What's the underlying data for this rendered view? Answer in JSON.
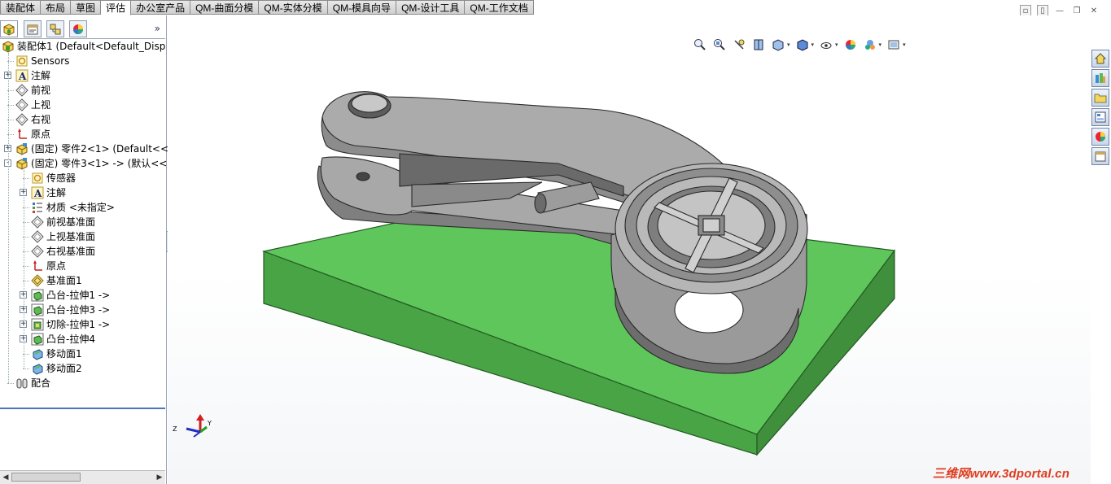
{
  "tabs": [
    {
      "label": "装配体",
      "active": false
    },
    {
      "label": "布局",
      "active": false
    },
    {
      "label": "草图",
      "active": false
    },
    {
      "label": "评估",
      "active": true
    },
    {
      "label": "办公室产品",
      "active": false
    },
    {
      "label": "QM-曲面分模",
      "active": false
    },
    {
      "label": "QM-实体分模",
      "active": false
    },
    {
      "label": "QM-模具向导",
      "active": false
    },
    {
      "label": "QM-设计工具",
      "active": false
    },
    {
      "label": "QM-工作文档",
      "active": false
    }
  ],
  "panel": {
    "more_glyph": "»",
    "tabs": [
      "featuremanager-icon",
      "propertymanager-icon",
      "configurationmanager-icon",
      "appearance-icon"
    ]
  },
  "tree": [
    {
      "label": "装配体1  (Default<Default_Disp",
      "icon": "assembly-icon",
      "level": 0,
      "expander": ""
    },
    {
      "label": "Sensors",
      "icon": "sensor-icon",
      "level": 1,
      "expander": ""
    },
    {
      "label": "注解",
      "icon": "annotation-icon",
      "level": 1,
      "expander": "+"
    },
    {
      "label": "前视",
      "icon": "plane-icon",
      "level": 1,
      "expander": ""
    },
    {
      "label": "上视",
      "icon": "plane-icon",
      "level": 1,
      "expander": ""
    },
    {
      "label": "右视",
      "icon": "plane-icon",
      "level": 1,
      "expander": ""
    },
    {
      "label": "原点",
      "icon": "origin-icon",
      "level": 1,
      "expander": ""
    },
    {
      "label": "(固定) 零件2<1> (Default<<D",
      "icon": "part-icon",
      "level": 1,
      "expander": "+"
    },
    {
      "label": "(固定) 零件3<1> -> (默认<<默",
      "icon": "part-icon",
      "level": 1,
      "expander": "-"
    },
    {
      "label": "传感器",
      "icon": "sensor-icon",
      "level": 2,
      "expander": ""
    },
    {
      "label": "注解",
      "icon": "annotation-icon",
      "level": 2,
      "expander": "+"
    },
    {
      "label": "材质 <未指定>",
      "icon": "material-icon",
      "level": 2,
      "expander": ""
    },
    {
      "label": "前视基准面",
      "icon": "plane-icon",
      "level": 2,
      "expander": ""
    },
    {
      "label": "上视基准面",
      "icon": "plane-icon",
      "level": 2,
      "expander": ""
    },
    {
      "label": "右视基准面",
      "icon": "plane-icon",
      "level": 2,
      "expander": ""
    },
    {
      "label": "原点",
      "icon": "origin-icon",
      "level": 2,
      "expander": ""
    },
    {
      "label": "基准面1",
      "icon": "ref-plane-icon",
      "level": 2,
      "expander": ""
    },
    {
      "label": "凸台-拉伸1 ->",
      "icon": "boss-extrude-icon",
      "level": 2,
      "expander": "+"
    },
    {
      "label": "凸台-拉伸3 ->",
      "icon": "boss-extrude-icon",
      "level": 2,
      "expander": "+"
    },
    {
      "label": "切除-拉伸1 ->",
      "icon": "cut-extrude-icon",
      "level": 2,
      "expander": "+"
    },
    {
      "label": "凸台-拉伸4",
      "icon": "boss-extrude-icon",
      "level": 2,
      "expander": "+"
    },
    {
      "label": "移动面1",
      "icon": "move-face-icon",
      "level": 2,
      "expander": ""
    },
    {
      "label": "移动面2",
      "icon": "move-face-icon",
      "level": 2,
      "expander": ""
    },
    {
      "label": "配合",
      "icon": "mates-icon",
      "level": 1,
      "expander": ""
    }
  ],
  "triad": {
    "x": "X",
    "y": "Y",
    "z": "Z"
  },
  "headsup_icons": [
    "zoom-to-fit-icon",
    "zoom-to-area-icon",
    "previous-view-icon",
    "section-view-icon",
    "view-orientation-icon",
    "display-style-icon",
    "hide-show-items-icon",
    "edit-appearance-icon",
    "apply-scene-icon",
    "view-settings-icon"
  ],
  "taskpane_icons": [
    "solidworks-resources-icon",
    "design-library-icon",
    "file-explorer-icon",
    "view-palette-icon",
    "appearances-scenes-icon",
    "custom-properties-icon"
  ],
  "watermark": "三维网www.3dportal.cn",
  "colors": {
    "base_plate": "#5fc65c",
    "part": "#9a9a9a",
    "accent": "#4a78b8",
    "watermark": "#e03b1e"
  }
}
